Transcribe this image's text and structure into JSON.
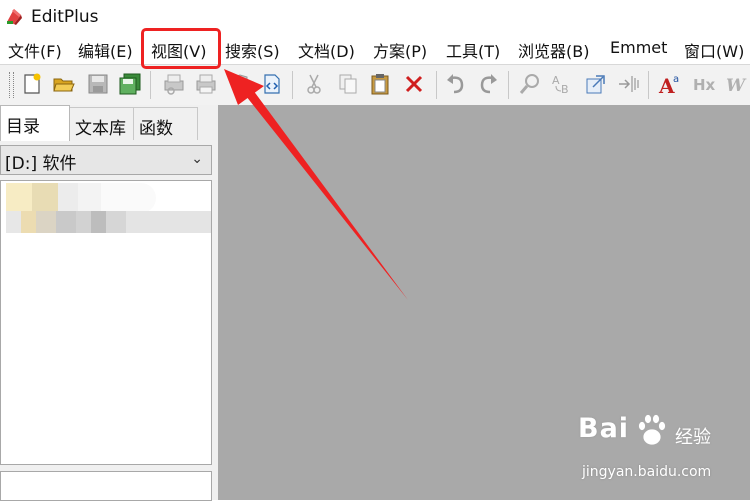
{
  "window": {
    "title": "EditPlus"
  },
  "menu": {
    "items": [
      {
        "label": "文件(F)"
      },
      {
        "label": "编辑(E)"
      },
      {
        "label": "视图(V)"
      },
      {
        "label": "搜索(S)"
      },
      {
        "label": "文档(D)"
      },
      {
        "label": "方案(P)"
      },
      {
        "label": "工具(T)"
      },
      {
        "label": "浏览器(B)"
      },
      {
        "label": "Emmet"
      },
      {
        "label": "窗口(W)"
      }
    ]
  },
  "toolbar": {
    "icons": [
      "new-file-icon",
      "open-folder-icon",
      "save-icon",
      "save-all-icon",
      "print-preview-icon",
      "print-icon",
      "spell-check-icon",
      "browser-view-icon",
      "cut-icon",
      "copy-icon",
      "paste-icon",
      "delete-icon",
      "undo-icon",
      "redo-icon",
      "find-icon",
      "replace-icon",
      "goto-icon",
      "indent-icon",
      "font-icon",
      "heading-icon",
      "italic-icon"
    ]
  },
  "left_panel": {
    "tabs": [
      {
        "label": "目录",
        "active": true
      },
      {
        "label": "文本库",
        "active": false
      },
      {
        "label": "函数",
        "active": false
      }
    ],
    "drive": "[D:] 软件"
  },
  "watermark": {
    "brand_left": "Bai",
    "brand_right": "经验",
    "url": "jingyan.baidu.com"
  },
  "colors": {
    "highlight": "#ee2222",
    "editor_bg": "#a9a9a9",
    "panel_bg": "#f0f0f0"
  }
}
